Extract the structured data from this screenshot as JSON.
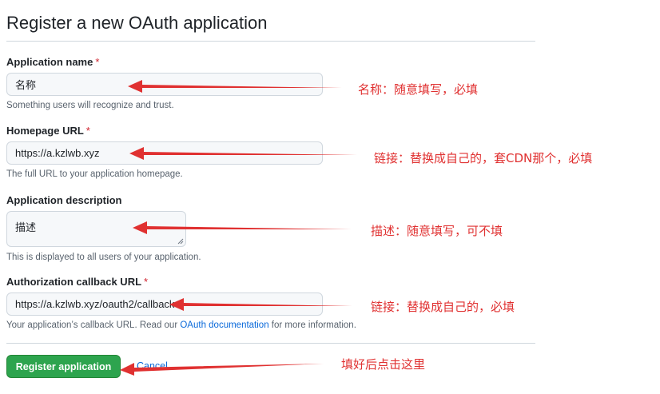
{
  "page": {
    "title": "Register a new OAuth application"
  },
  "form": {
    "required_mark": "*",
    "app_name": {
      "label": "Application name",
      "value": "名称",
      "hint": "Something users will recognize and trust."
    },
    "homepage_url": {
      "label": "Homepage URL",
      "value": "https://a.kzlwb.xyz",
      "hint": "The full URL to your application homepage."
    },
    "description": {
      "label": "Application description",
      "value": "描述",
      "hint": "This is displayed to all users of your application."
    },
    "callback_url": {
      "label": "Authorization callback URL",
      "value": "https://a.kzlwb.xyz/oauth2/callback",
      "hint_before": "Your application’s callback URL. Read our ",
      "hint_link": "OAuth documentation",
      "hint_after": " for more information."
    },
    "register_button": "Register application",
    "cancel_link": "Cancel"
  },
  "annotations": {
    "name_note": "名称：随意填写，必填",
    "homepage_note": "链接：替换成自己的，套CDN那个，必填",
    "description_note": "描述：随意填写，可不填",
    "callback_note": "链接：替换成自己的，必填",
    "button_note": "填好后点击这里"
  },
  "colors": {
    "primary_button": "#2da44e",
    "link": "#0969da",
    "required": "#cf222e",
    "annotation_red": "#e03131"
  }
}
